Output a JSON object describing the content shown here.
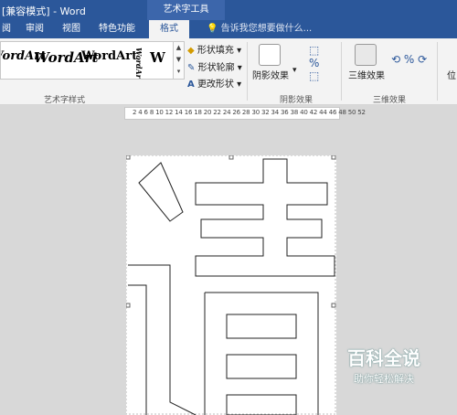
{
  "titlebar": {
    "title": "[兼容模式] - Word",
    "context_tab_group": "艺术字工具"
  },
  "tabs": [
    "审阅",
    "视图",
    "特色功能",
    "格式"
  ],
  "tellme": "告诉我您想要做什么...",
  "wordart_group": {
    "samples": [
      "WordArt",
      "WordArt",
      "WordArt",
      "WordArt",
      "W"
    ],
    "label": "艺术字样式"
  },
  "shape_commands": {
    "fill": "形状填充",
    "outline": "形状轮廓",
    "change": "更改形状"
  },
  "shadow_group": {
    "button": "阴影效果",
    "label": "阴影效果"
  },
  "three_d_group": {
    "button": "三维效果",
    "label": "三维效果"
  },
  "position_button": "位",
  "ruler": "2 4 6 8 10 12 14 16 18 20 22 24 26 28 30 32 34 36 38 40 42 44 46 48 50 52",
  "watermark": {
    "title": "百科全说",
    "subtitle": "助你轻松解决"
  },
  "colors": {
    "title_bar": "#2b579a",
    "ribbon": "#f3f3f3",
    "workspace": "#d8d8d8"
  },
  "icons": [
    "fill-bucket-icon",
    "outline-pen-icon",
    "text-a-icon",
    "shadow-icon",
    "3d-cube-icon",
    "lightbulb-icon"
  ]
}
